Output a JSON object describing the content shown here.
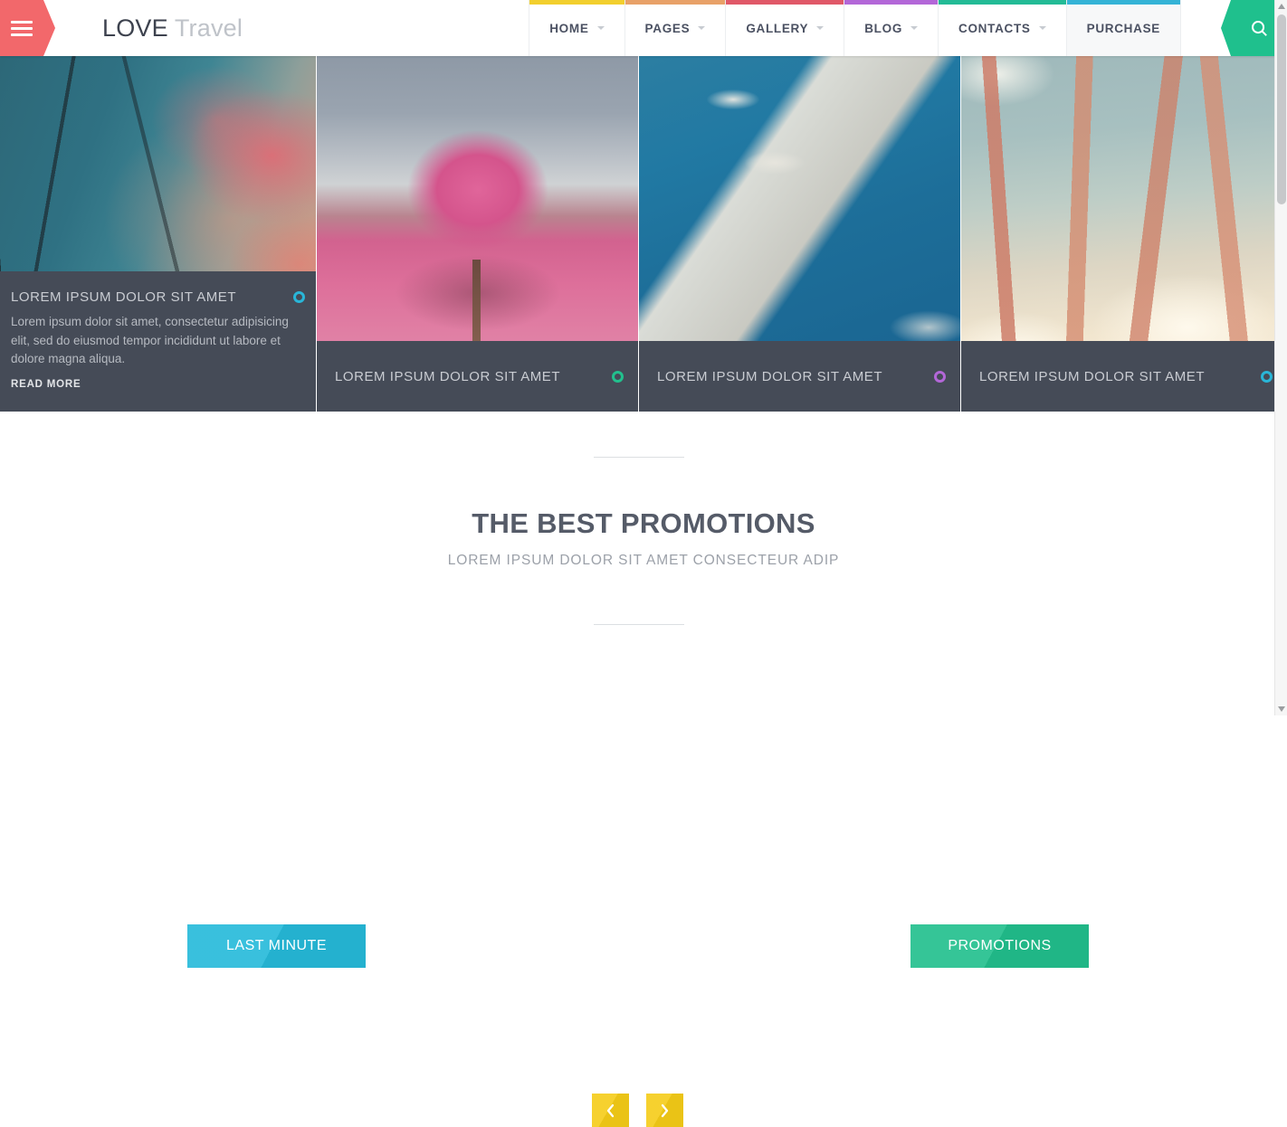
{
  "header": {
    "menu_icon": "hamburger-icon",
    "logo": {
      "bold": "LOVE",
      "light": "Travel"
    },
    "search_icon": "search-icon",
    "nav": [
      {
        "label": "HOME",
        "color": "#f2cf2e",
        "caret": true,
        "active": false
      },
      {
        "label": "PAGES",
        "color": "#e8a168",
        "caret": true,
        "active": false
      },
      {
        "label": "GALLERY",
        "color": "#e05868",
        "caret": true,
        "active": false
      },
      {
        "label": "BLOG",
        "color": "#b367d8",
        "caret": true,
        "active": false
      },
      {
        "label": "CONTACTS",
        "color": "#23bb96",
        "caret": true,
        "active": false
      },
      {
        "label": "PURCHASE",
        "color": "#34b3d6",
        "caret": false,
        "active": true
      }
    ]
  },
  "slider": {
    "slides": [
      {
        "title": "LOREM IPSUM DOLOR SIT AMET",
        "description": "Lorem ipsum dolor sit amet, consectetur adipisicing elit, sed do eiusmod tempor incididunt ut labore et dolore magna aliqua.",
        "read_more": "READ MORE",
        "dot_color": "#29b6d8",
        "expanded": true,
        "image": "misty-forest-pink-foliage"
      },
      {
        "title": "LOREM IPSUM DOLOR SIT AMET",
        "dot_color": "#22c08d",
        "expanded": false,
        "image": "pink-tree-meadow"
      },
      {
        "title": "LOREM IPSUM DOLOR SIT AMET",
        "dot_color": "#b367d8",
        "expanded": false,
        "image": "ocean-rock-coast"
      },
      {
        "title": "LOREM IPSUM DOLOR SIT AMET",
        "dot_color": "#29b6d8",
        "expanded": false,
        "image": "golden-wheat-sky"
      }
    ]
  },
  "promotions": {
    "title": "THE BEST PROMOTIONS",
    "subtitle": "LOREM IPSUM DOLOR SIT AMET CONSECTEUR ADIP",
    "left_button": {
      "label": "LAST MINUTE",
      "color": "#26bada"
    },
    "right_button": {
      "label": "PROMOTIONS",
      "color": "#22c08d"
    },
    "prev_icon": "chevron-left-icon",
    "next_icon": "chevron-right-icon",
    "arrow_color": "#f5cc17"
  },
  "scrollbar": {
    "up_icon": "scroll-up-icon",
    "down_icon": "scroll-down-icon"
  }
}
